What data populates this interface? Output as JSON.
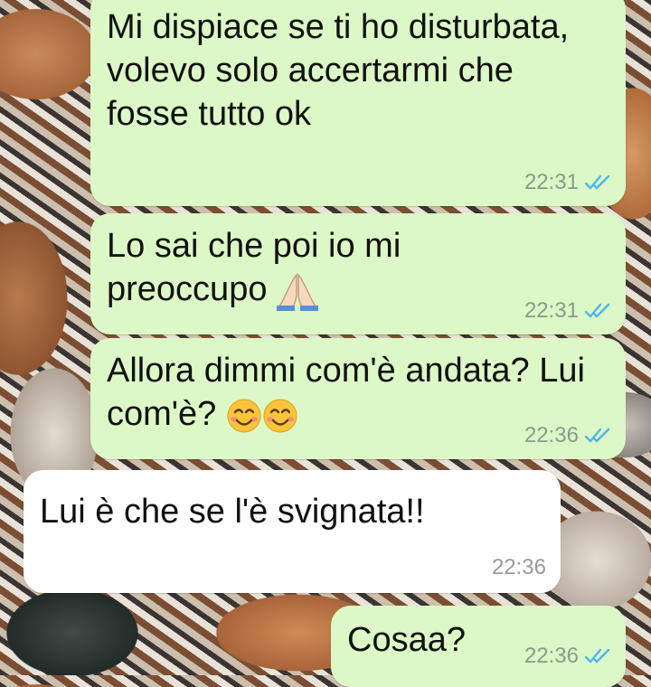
{
  "messages": [
    {
      "direction": "outgoing",
      "text": "Mi dispiace se ti ho disturbata, volevo solo accertarmi che fosse tutto ok",
      "time": "22:31",
      "status": "read"
    },
    {
      "direction": "outgoing",
      "text": "Lo sai che poi io mi preoccupo",
      "emoji": "folded-hands",
      "time": "22:31",
      "status": "read"
    },
    {
      "direction": "outgoing",
      "text": "Allora dimmi com'è andata? Lui com'è?",
      "emoji": "smiling-face-with-smiling-eyes x2",
      "time": "22:36",
      "status": "read"
    },
    {
      "direction": "incoming",
      "text": "Lui è che se l'è svignata!!",
      "time": "22:36"
    },
    {
      "direction": "outgoing",
      "text": "Cosaa?",
      "time": "22:36",
      "status": "read"
    }
  ],
  "colors": {
    "outgoing_bubble": "#dcf8c6",
    "incoming_bubble": "#ffffff",
    "read_ticks": "#4fb6ec",
    "timestamp": "#8a9a8e"
  }
}
